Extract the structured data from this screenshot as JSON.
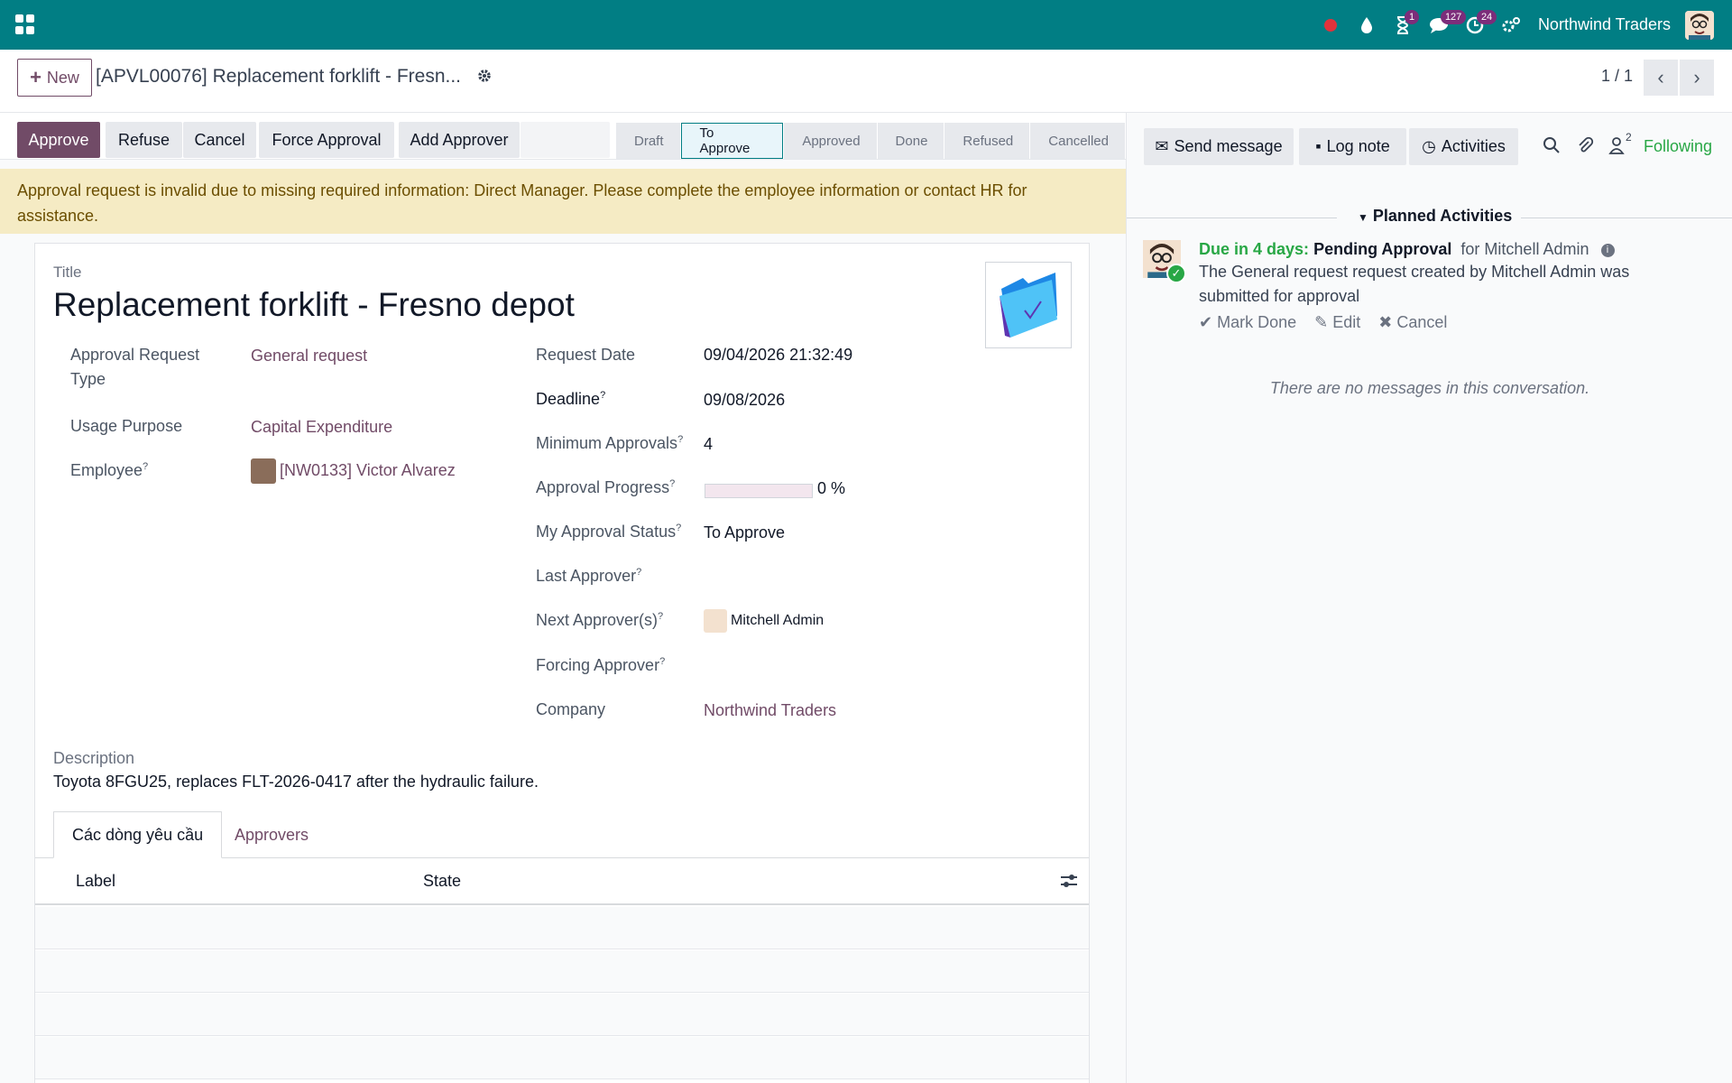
{
  "navbar": {
    "company": "Northwind Traders",
    "badges": {
      "activities": "1",
      "messages": "127",
      "clock": "24"
    }
  },
  "control": {
    "new_label": "New",
    "breadcrumb": "[APVL00076] Replacement forklift - Fresn...",
    "pager": "1 / 1"
  },
  "actions": {
    "approve": "Approve",
    "refuse": "Refuse",
    "cancel": "Cancel",
    "force_approval": "Force Approval",
    "add_approver": "Add Approver"
  },
  "stages": [
    "Draft",
    "To Approve",
    "Approved",
    "Done",
    "Refused",
    "Cancelled"
  ],
  "active_stage": "To Approve",
  "alert": "Approval request is invalid due to missing required information: Direct Manager. Please complete the employee information or contact HR for assistance.",
  "form": {
    "title_label": "Title",
    "title": "Replacement forklift - Fresno depot",
    "left": {
      "request_type_label_1": "Approval Request",
      "request_type_label_2": "Type",
      "request_type": "General request",
      "usage_label": "Usage Purpose",
      "usage": "Capital Expenditure",
      "employee_label": "Employee",
      "employee": "[NW0133] Victor Alvarez"
    },
    "right": {
      "request_date_label": "Request Date",
      "request_date": "09/04/2026 21:32:49",
      "deadline_label": "Deadline",
      "deadline": "09/08/2026",
      "min_approvals_label": "Minimum Approvals",
      "min_approvals": "4",
      "progress_label": "Approval Progress",
      "progress_text": "0 %",
      "progress_value": 0,
      "my_status_label": "My Approval Status",
      "my_status": "To Approve",
      "last_approver_label": "Last Approver",
      "next_approvers_label": "Next Approver(s)",
      "next_approver": "Mitchell Admin",
      "forcing_label": "Forcing Approver",
      "company_label": "Company",
      "company": "Northwind Traders"
    },
    "help_mark": "?",
    "description_label": "Description",
    "description": "Toyota 8FGU25, replaces FLT-2026-0417 after the hydraulic failure.",
    "tabs": [
      "Các dòng yêu cầu",
      "Approvers"
    ],
    "table_headers": [
      "Label",
      "State"
    ]
  },
  "chatter": {
    "send_message": "Send message",
    "log_note": "Log note",
    "activities": "Activities",
    "followers_count": "2",
    "following": "Following",
    "planned_title": "Planned Activities",
    "activity": {
      "due": "Due in 4 days:",
      "summary": "Pending Approval",
      "for": "for Mitchell Admin",
      "body": "The General request request created by Mitchell Admin was submitted for approval",
      "mark_done": "Mark Done",
      "edit": "Edit",
      "cancel": "Cancel"
    },
    "no_messages": "There are no messages in this conversation."
  },
  "colors": {
    "navbar": "#017e84",
    "primary": "#714b67",
    "success": "#28a745",
    "alert_bg": "#f5ebc4"
  }
}
